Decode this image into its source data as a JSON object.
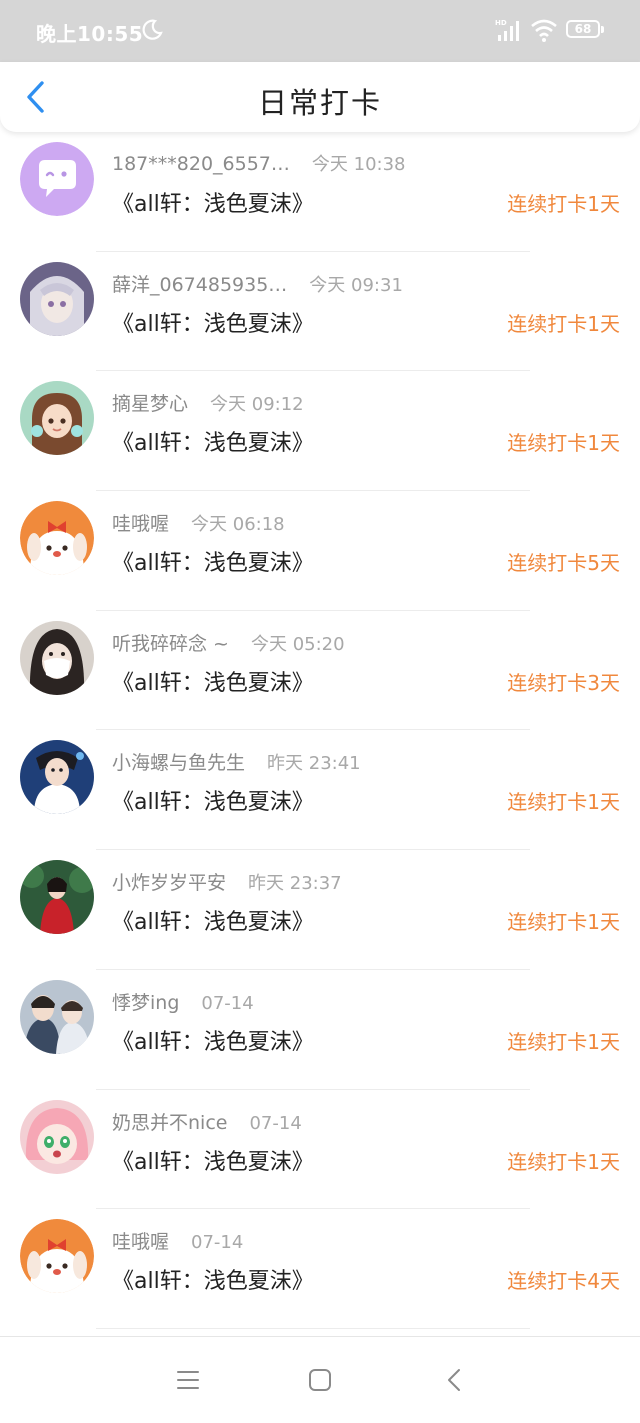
{
  "status_bar": {
    "time": "晚上10:55",
    "battery": "68"
  },
  "header": {
    "title": "日常打卡"
  },
  "checkins": [
    {
      "user": "187***820_6557…",
      "time": "今天 10:38",
      "book": "《all轩：浅色夏沫》",
      "streak": "连续打卡1天"
    },
    {
      "user": "薛洋_067485935…",
      "time": "今天 09:31",
      "book": "《all轩：浅色夏沫》",
      "streak": "连续打卡1天"
    },
    {
      "user": "摘星梦心",
      "time": "今天 09:12",
      "book": "《all轩：浅色夏沫》",
      "streak": "连续打卡1天"
    },
    {
      "user": "哇哦喔",
      "time": "今天 06:18",
      "book": "《all轩：浅色夏沫》",
      "streak": "连续打卡5天"
    },
    {
      "user": "听我碎碎念 ~",
      "time": "今天 05:20",
      "book": "《all轩：浅色夏沫》",
      "streak": "连续打卡3天"
    },
    {
      "user": "小海螺与鱼先生",
      "time": "昨天 23:41",
      "book": "《all轩：浅色夏沫》",
      "streak": "连续打卡1天"
    },
    {
      "user": "小炸岁岁平安",
      "time": "昨天 23:37",
      "book": "《all轩：浅色夏沫》",
      "streak": "连续打卡1天"
    },
    {
      "user": "悸梦ing",
      "time": "07-14",
      "book": "《all轩：浅色夏沫》",
      "streak": "连续打卡1天"
    },
    {
      "user": "奶思并不nice",
      "time": "07-14",
      "book": "《all轩：浅色夏沫》",
      "streak": "连续打卡1天"
    },
    {
      "user": "哇哦喔",
      "time": "07-14",
      "book": "《all轩：浅色夏沫》",
      "streak": "连续打卡4天"
    }
  ],
  "colors": {
    "accent": "#f0883d",
    "back": "#2f8ff0",
    "status_bar": "#d6d6d6"
  },
  "icons": [
    "moon-icon",
    "signal-icon",
    "wifi-icon",
    "back-arrow-icon",
    "menu-icon",
    "home-icon",
    "back-nav-icon"
  ]
}
